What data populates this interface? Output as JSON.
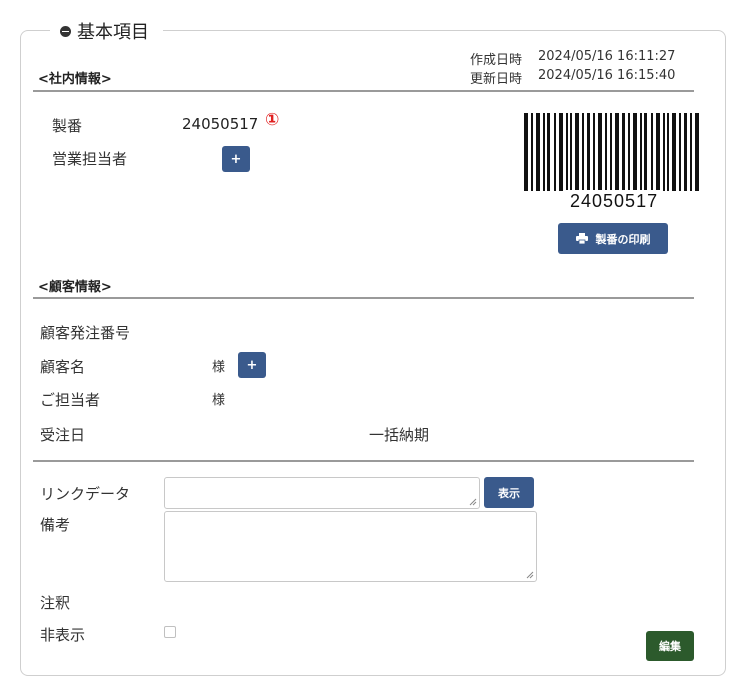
{
  "section": {
    "title": "基本項目"
  },
  "internal": {
    "header": "<社内情報>",
    "created_label": "作成日時",
    "created_value": "2024/05/16 16:11:27",
    "updated_label": "更新日時",
    "updated_value": "2024/05/16 16:15:40",
    "seiban_label": "製番",
    "seiban_value": "24050517",
    "marker": "①",
    "sales_label": "営業担当者",
    "add_label": "+",
    "barcode_text": "24050517",
    "print_button": "製番の印刷"
  },
  "customer": {
    "header": "<顧客情報>",
    "order_no_label": "顧客発注番号",
    "name_label": "顧客名",
    "name_suffix": "様",
    "add_label": "+",
    "contact_label": "ご担当者",
    "contact_suffix": "様",
    "order_date_label": "受注日",
    "bulk_delivery_label": "一括納期"
  },
  "misc": {
    "link_label": "リンクデータ",
    "link_value": "",
    "show_button": "表示",
    "notes_label": "備考",
    "notes_value": "",
    "annotation_label": "注釈",
    "hidden_label": "非表示",
    "hidden_checked": false,
    "edit_button": "編集"
  },
  "colors": {
    "primary": "#3a5a8c",
    "success": "#2c5a2c",
    "marker": "#e02020"
  },
  "icons": [
    "minus-circle-icon",
    "plus-icon",
    "printer-icon",
    "resize-grip-icon",
    "barcode"
  ]
}
